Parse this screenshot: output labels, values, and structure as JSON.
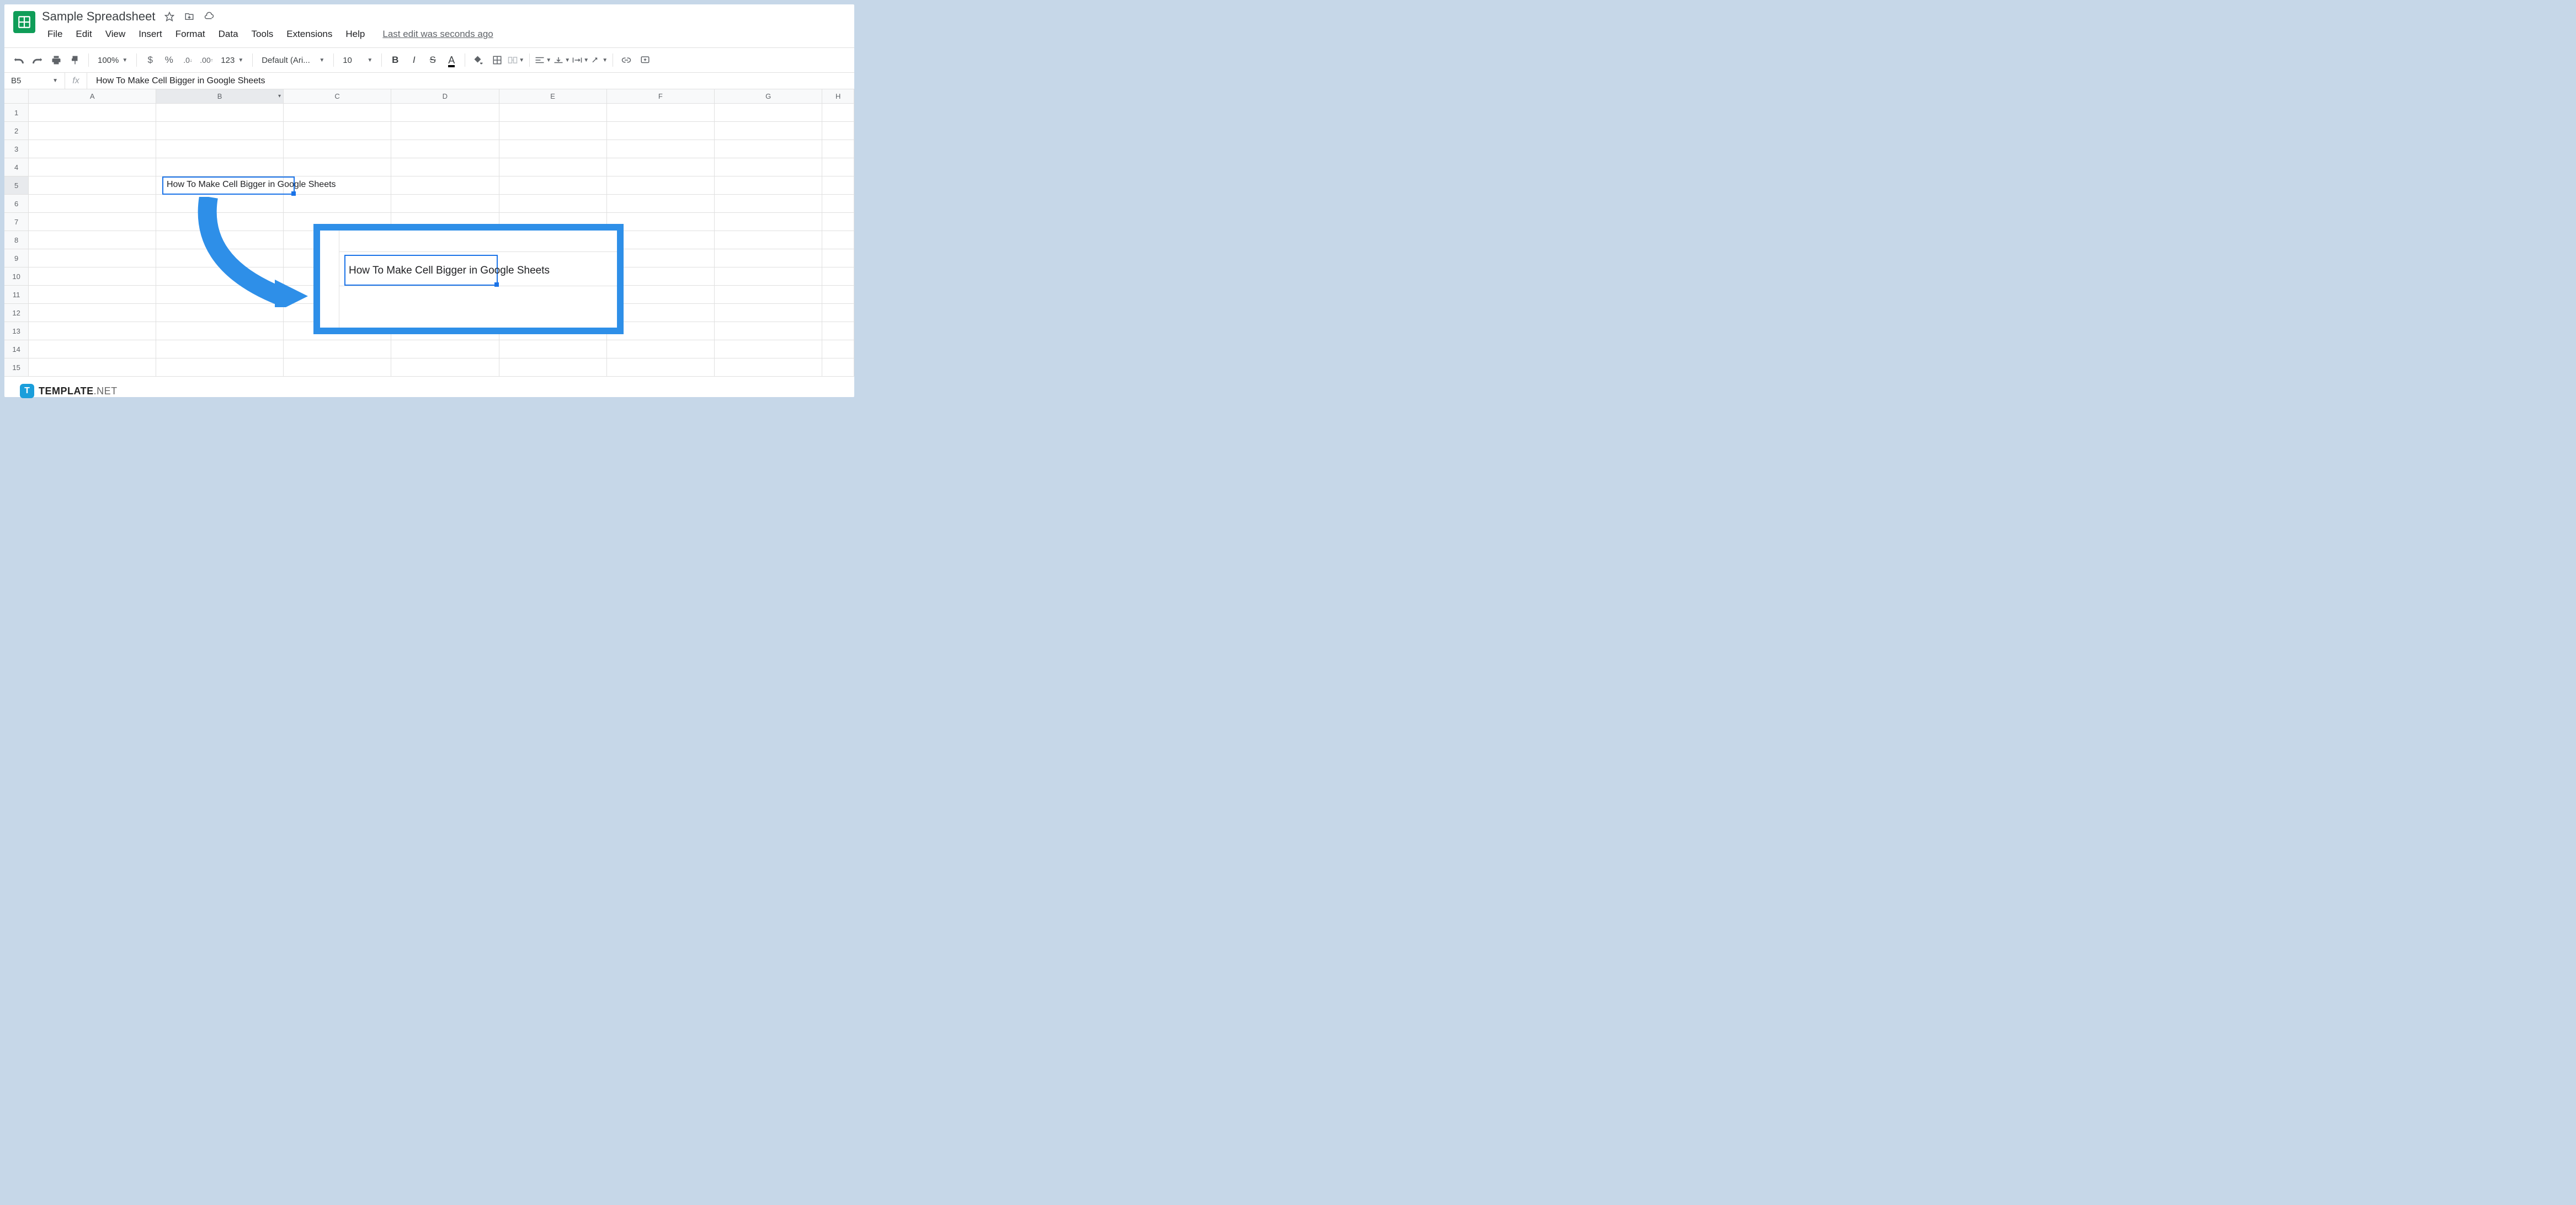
{
  "doc": {
    "title": "Sample Spreadsheet",
    "last_edit": "Last edit was seconds ago"
  },
  "menus": [
    "File",
    "Edit",
    "View",
    "Insert",
    "Format",
    "Data",
    "Tools",
    "Extensions",
    "Help"
  ],
  "toolbar": {
    "zoom": "100%",
    "font": "Default (Ari...",
    "size": "10"
  },
  "formula": {
    "name_box": "B5",
    "value": "How To Make Cell Bigger in Google Sheets"
  },
  "columns": [
    "A",
    "B",
    "C",
    "D",
    "E",
    "F",
    "G",
    "H"
  ],
  "rows": [
    "1",
    "2",
    "3",
    "4",
    "5",
    "6",
    "7",
    "8",
    "9",
    "10",
    "11",
    "12",
    "13",
    "14",
    "15"
  ],
  "selected": {
    "col": "B",
    "row": "5"
  },
  "cells": {
    "B5": "How To Make Cell Bigger in Google Sheets"
  },
  "callout": {
    "text": "How To Make Cell Bigger in Google Sheets"
  },
  "watermark": {
    "logo": "T",
    "brand": "TEMPLATE",
    "suffix": ".NET"
  }
}
